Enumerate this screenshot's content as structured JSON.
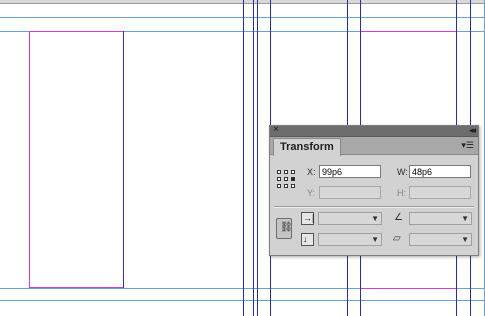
{
  "panel": {
    "title": "Transform",
    "close_icon": "close-icon",
    "collapse_icon": "double-chevron-left-icon",
    "menu_icon": "panel-menu-icon",
    "fields": {
      "x_label": "X:",
      "x_value": "99p6",
      "y_label": "Y:",
      "y_value": "",
      "w_label": "W:",
      "w_value": "48p6",
      "h_label": "H:",
      "h_value": ""
    },
    "reference_point": {
      "icon": "reference-point-icon",
      "selected": "middle-right"
    },
    "constrain": {
      "icon": "link-chain-icon"
    },
    "scale_x": {
      "icon": "scale-x-icon",
      "value": ""
    },
    "scale_y": {
      "icon": "scale-y-icon",
      "value": ""
    },
    "rotate": {
      "icon": "rotate-angle-icon",
      "value": ""
    },
    "shear": {
      "icon": "shear-icon",
      "value": ""
    }
  },
  "colors": {
    "guide_blue": "#2a2ab8",
    "guide_cyan": "#6fa0c8",
    "margin_magenta": "#d040d0",
    "panel_bg": "#d2d2d2"
  }
}
